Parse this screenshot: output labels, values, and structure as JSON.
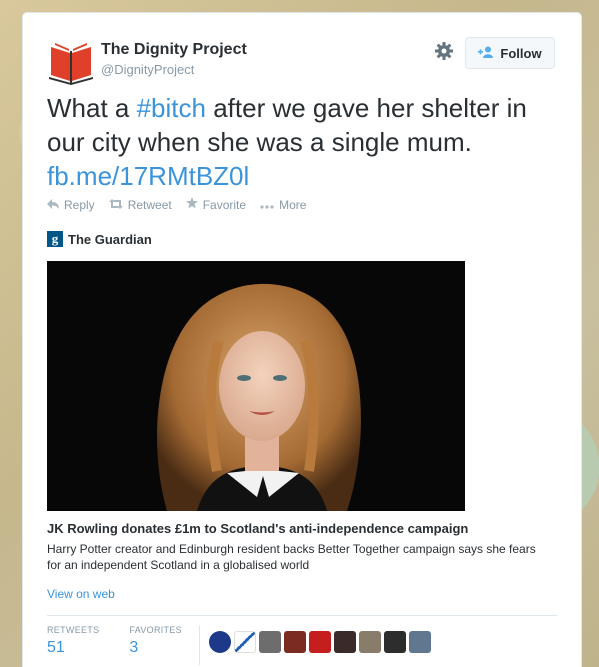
{
  "user": {
    "name": "The Dignity Project",
    "handle": "@DignityProject"
  },
  "follow_label": "Follow",
  "tweet": {
    "before": "What a ",
    "hashtag": "#bitch",
    "after": " after we gave her shelter in our city when she was a single mum. ",
    "link": "fb.me/17RMtBZ0l"
  },
  "actions": {
    "reply": "Reply",
    "retweet": "Retweet",
    "favorite": "Favorite",
    "more": "More"
  },
  "card": {
    "source": "The Guardian",
    "headline": "JK Rowling donates £1m to Scotland's anti-independence campaign",
    "description": "Harry Potter creator and Edinburgh resident backs Better Together campaign says she fears for an independent Scotland in a globalised world",
    "view_on_web": "View on web"
  },
  "stats": {
    "retweets_label": "RETWEETS",
    "retweets": "51",
    "favorites_label": "FAVORITES",
    "favorites": "3"
  },
  "colors": {
    "link": "#3b94d9",
    "text": "#292f33",
    "muted": "#8899a6",
    "guardian": "#005689"
  }
}
